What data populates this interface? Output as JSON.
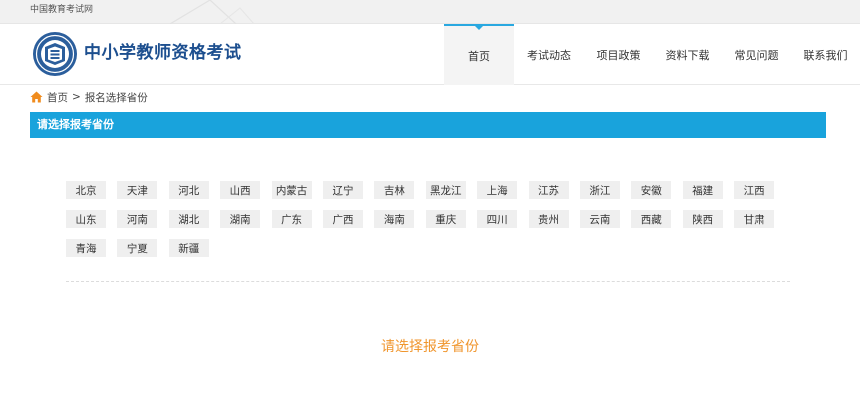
{
  "topbar": {
    "site_name": "中国教育考试网"
  },
  "header": {
    "site_title": "中小学教师资格考试"
  },
  "nav": {
    "items": [
      {
        "label": "首页",
        "active": true
      },
      {
        "label": "考试动态"
      },
      {
        "label": "项目政策"
      },
      {
        "label": "资料下载"
      },
      {
        "label": "常见问题"
      },
      {
        "label": "联系我们"
      }
    ]
  },
  "breadcrumb": {
    "home": "首页",
    "separator": ">",
    "current": "报名选择省份"
  },
  "section": {
    "title": "请选择报考省份"
  },
  "provinces": [
    "北京",
    "天津",
    "河北",
    "山西",
    "内蒙古",
    "辽宁",
    "吉林",
    "黑龙江",
    "上海",
    "江苏",
    "浙江",
    "安徽",
    "福建",
    "江西",
    "山东",
    "河南",
    "湖北",
    "湖南",
    "广东",
    "广西",
    "海南",
    "重庆",
    "四川",
    "贵州",
    "云南",
    "西藏",
    "陕西",
    "甘肃",
    "青海",
    "宁夏",
    "新疆"
  ],
  "prompt": "请选择报考省份",
  "colors": {
    "accent": "#19a3dc",
    "brand": "#1d4f8f",
    "prompt": "#f0962e",
    "home_icon": "#f08c1e"
  }
}
